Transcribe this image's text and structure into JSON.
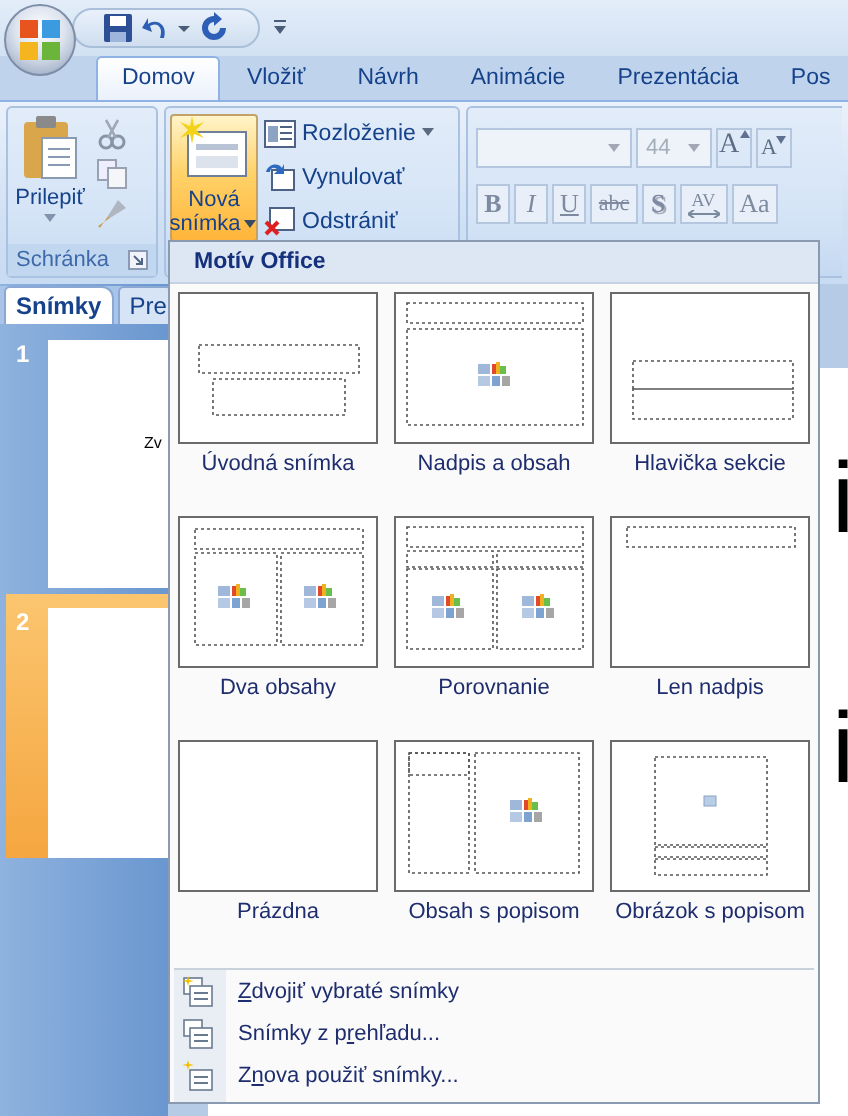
{
  "tabs": [
    {
      "label": "Domov",
      "selected": true
    },
    {
      "label": "Vložiť",
      "selected": false
    },
    {
      "label": "Návrh",
      "selected": false
    },
    {
      "label": "Animácie",
      "selected": false
    },
    {
      "label": "Prezentácia",
      "selected": false
    },
    {
      "label": "Pos",
      "selected": false
    }
  ],
  "clipboard": {
    "paste": "Prilepiť",
    "group_label": "Schránka"
  },
  "slides_group": {
    "new_slide": [
      "Nová",
      "snímka"
    ],
    "new_slide_open": true,
    "layout": "Rozloženie",
    "reset": "Vynulovať",
    "delete": "Odstrániť"
  },
  "font": {
    "size": "44",
    "disabled": true,
    "grow": "A",
    "shrink": "A"
  },
  "format_buttons": [
    {
      "label": "B",
      "kind": "bold"
    },
    {
      "label": "I",
      "kind": "italic"
    },
    {
      "label": "U",
      "kind": "underline"
    },
    {
      "label": "abc",
      "kind": "strike"
    },
    {
      "label": "S",
      "kind": "shadow"
    },
    {
      "label": "AV",
      "kind": "spacing"
    },
    {
      "label": "Aa",
      "kind": "case"
    }
  ],
  "pane_tabs": [
    {
      "label": "Snímky",
      "selected": true
    },
    {
      "label": "Pre",
      "selected": false
    }
  ],
  "slides": [
    {
      "number": "1",
      "text": "Zv",
      "selected": false
    },
    {
      "number": "2",
      "selected": true
    }
  ],
  "slide_texts": [
    "i",
    "i"
  ],
  "menu": {
    "title": "Motív Office",
    "layouts": [
      {
        "label": "Úvodná snímka",
        "kind": "title"
      },
      {
        "label": "Nadpis a obsah",
        "kind": "title-content"
      },
      {
        "label": "Hlavička sekcie",
        "kind": "section-header"
      },
      {
        "label": "Dva obsahy",
        "kind": "two-content"
      },
      {
        "label": "Porovnanie",
        "kind": "comparison"
      },
      {
        "label": "Len nadpis",
        "kind": "title-only"
      },
      {
        "label": "Prázdna",
        "kind": "blank"
      },
      {
        "label": "Obsah s popisom",
        "kind": "content-caption"
      },
      {
        "label": "Obrázok s popisom",
        "kind": "picture-caption"
      }
    ],
    "commands": [
      {
        "key": "Z",
        "after": "dvojiť vybraté snímky",
        "kind": "duplicate"
      },
      {
        "before": "Snímky z p",
        "key": "r",
        "after": "ehľadu...",
        "kind": "outline"
      },
      {
        "before": "Z",
        "key": "n",
        "after": "ova použiť snímky...",
        "kind": "reuse"
      }
    ]
  }
}
